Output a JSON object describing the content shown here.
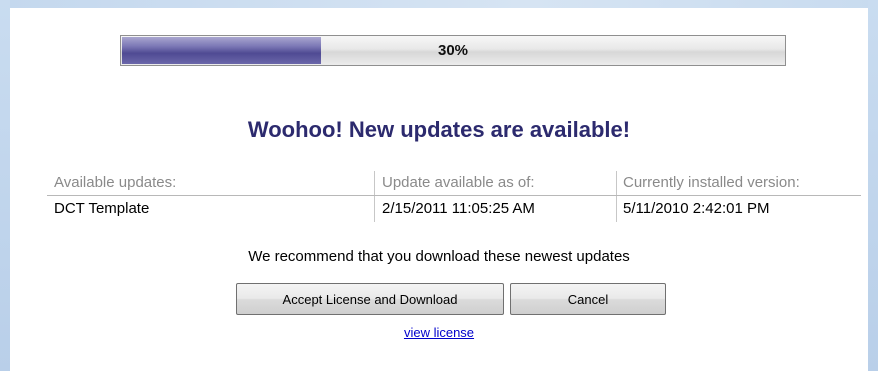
{
  "progress": {
    "value": 0.3,
    "label": "30%"
  },
  "headline": "Woohoo! New updates are available!",
  "table": {
    "headers": [
      "Available updates:",
      "Update available as of:",
      "Currently installed version:"
    ],
    "rows": [
      [
        "DCT Template",
        "2/15/2011 11:05:25 AM",
        "5/11/2010 2:42:01 PM"
      ]
    ]
  },
  "recommendation": "We recommend that you download these newest updates",
  "buttons": {
    "accept": "Accept License and Download",
    "cancel": "Cancel"
  },
  "link": {
    "view_license": "view license"
  },
  "colors": {
    "headline": "#2c2a6e",
    "progress_fill": "#4f4a93",
    "link": "#0000cc"
  }
}
